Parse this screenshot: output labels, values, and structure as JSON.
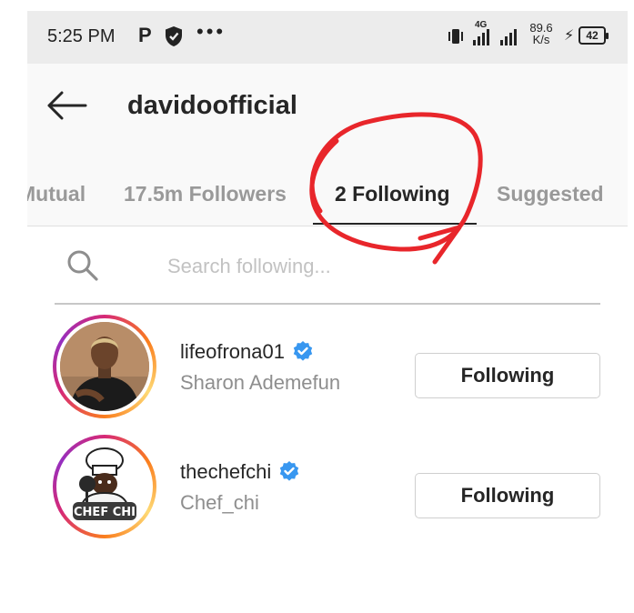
{
  "status_bar": {
    "time": "5:25 PM",
    "p_badge": "P",
    "dots": "•••",
    "net_type": "4G",
    "speed_value": "89.6",
    "speed_unit": "K/s",
    "bolt": "⚡",
    "battery": "42"
  },
  "header": {
    "title": "davidoofficial",
    "tabs": [
      {
        "label": "Mutual",
        "active": false
      },
      {
        "label": "17.5m Followers",
        "active": false
      },
      {
        "label": "2 Following",
        "active": true
      },
      {
        "label": "Suggested",
        "active": false
      }
    ]
  },
  "search": {
    "placeholder": "Search following..."
  },
  "following": [
    {
      "handle": "lifeofrona01",
      "name": "Sharon Ademefun",
      "verified": true,
      "button": "Following"
    },
    {
      "handle": "thechefchi",
      "name": "Chef_chi",
      "verified": true,
      "button": "Following"
    }
  ],
  "avatar_badge": "CHEF CHI",
  "colors": {
    "verified": "#3897f0",
    "annotation": "#e8262b",
    "inactive_tab": "#999999",
    "secondary_text": "#8e8e8e"
  },
  "icons": [
    "back-arrow-icon",
    "search-icon",
    "verified-icon",
    "shield-icon"
  ]
}
